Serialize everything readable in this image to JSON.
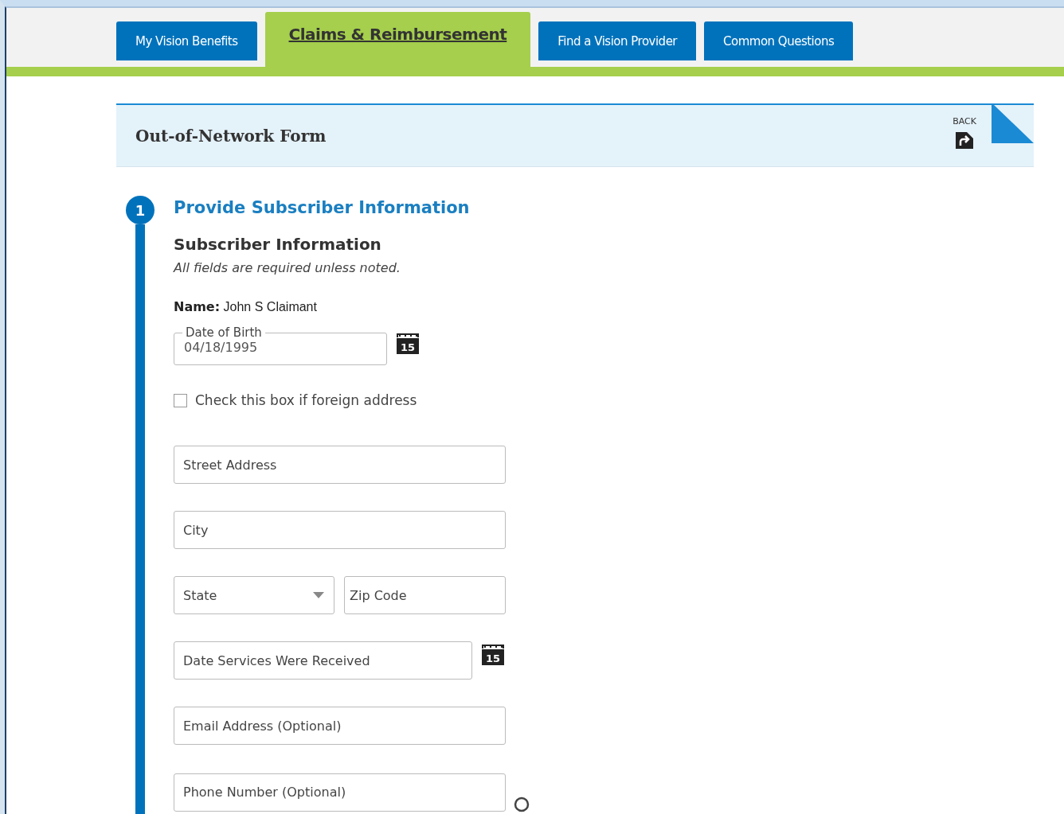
{
  "tabs": [
    {
      "label": "My Vision Benefits",
      "selected": false
    },
    {
      "label": "Claims & Reimbursement",
      "selected": true
    },
    {
      "label": "Find a Vision Provider",
      "selected": false
    },
    {
      "label": "Common Questions",
      "selected": false
    }
  ],
  "header": {
    "title": "Out-of-Network Form",
    "back_label": "BACK"
  },
  "step": {
    "number": "1",
    "title": "Provide Subscriber Information"
  },
  "section": {
    "title": "Subscriber Information",
    "note": "All fields are required unless noted.",
    "name_label": "Name:",
    "name_value": "John S Claimant"
  },
  "date_of_birth": {
    "label": "Date of Birth",
    "value": "04/18/1995",
    "calendar_day": "15"
  },
  "foreign_address": {
    "label": "Check this box if foreign address",
    "checked": false
  },
  "fields": [
    {
      "kind": "text",
      "placeholder": "Street Address"
    },
    {
      "kind": "text",
      "placeholder": "City"
    },
    {
      "kind": "pair",
      "items": [
        {
          "kind": "select",
          "placeholder": "State"
        },
        {
          "kind": "text",
          "placeholder": "Zip Code"
        }
      ]
    },
    {
      "kind": "date",
      "placeholder": "Date Services Were Received",
      "calendar_day": "15"
    },
    {
      "kind": "text",
      "placeholder": "Email Address (Optional)"
    },
    {
      "kind": "help",
      "placeholder": "Phone Number (Optional)"
    }
  ]
}
